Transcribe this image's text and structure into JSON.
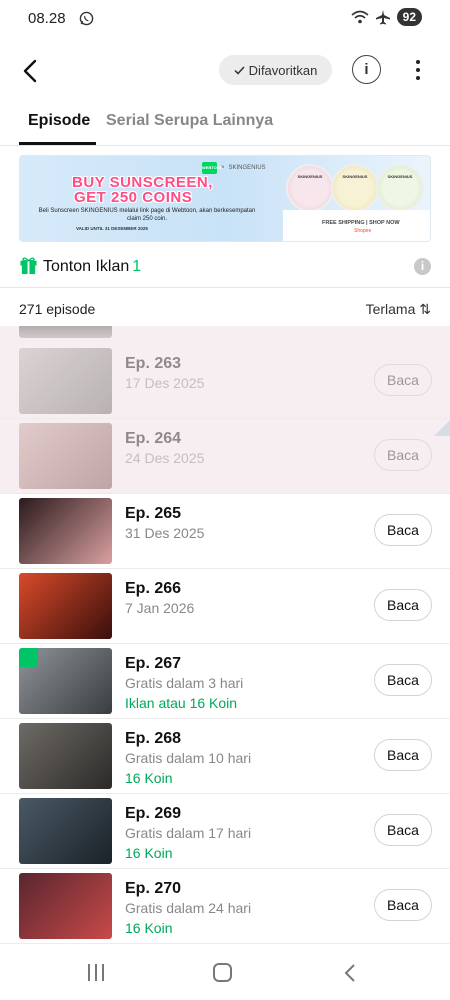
{
  "status_bar": {
    "time": "08.28",
    "battery": "92"
  },
  "header": {
    "favorite_label": "Difavoritkan",
    "info_label": "i"
  },
  "tabs": [
    {
      "label": "Episode"
    },
    {
      "label": "Serial Serupa Lainnya"
    }
  ],
  "banner": {
    "partner": "SKINGENIUS",
    "headline1": "BUY SUNSCREEN,",
    "headline2": "GET 250 COINS",
    "body": "Beli Sunscreen SKINGENIUS melalui link page di Webtoon, akan berkesempatan claim 250 coin.",
    "valid": "VALID UNTIL 31 DESEMBER 2025",
    "shipping": "FREE SHIPPING | SHOP NOW",
    "shop": "Shopee",
    "webtoon_logo": "WEBTOON",
    "cross": "×"
  },
  "ad_row": {
    "label": "Tonton Iklan",
    "count": "1"
  },
  "list_header": {
    "episode_count": "271 episode",
    "sort_label": "Terlama ⇅"
  },
  "episodes": [
    {
      "title": "Ep. 263",
      "line1": "17 Des 2025",
      "price": "",
      "button": "Baca",
      "faded": true,
      "thumb_colors": [
        "#b9b3b0",
        "#6d6866"
      ]
    },
    {
      "title": "Ep. 264",
      "line1": "24 Des 2025",
      "price": "",
      "button": "Baca",
      "faded": true,
      "thumb_colors": [
        "#c9a19c",
        "#7a4c4a"
      ]
    },
    {
      "title": "Ep. 265",
      "line1": "31 Des 2025",
      "price": "",
      "button": "Baca",
      "faded": false,
      "thumb_colors": [
        "#2b1a1c",
        "#d9a0a0"
      ]
    },
    {
      "title": "Ep. 266",
      "line1": "7 Jan 2026",
      "price": "",
      "button": "Baca",
      "faded": false,
      "thumb_colors": [
        "#d94a2a",
        "#3a0f0c"
      ]
    },
    {
      "title": "Ep. 267",
      "line1": "Gratis dalam 3 hari",
      "price": "Iklan atau 16 Koin",
      "button": "Baca",
      "faded": false,
      "thumb_colors": [
        "#8f9498",
        "#3a3d40"
      ]
    },
    {
      "title": "Ep. 268",
      "line1": "Gratis dalam 10 hari",
      "price": "16 Koin",
      "button": "Baca",
      "faded": false,
      "thumb_colors": [
        "#6e6a66",
        "#2c2a28"
      ]
    },
    {
      "title": "Ep. 269",
      "line1": "Gratis dalam 17 hari",
      "price": "16 Koin",
      "button": "Baca",
      "faded": false,
      "thumb_colors": [
        "#4a5966",
        "#1b2228"
      ]
    },
    {
      "title": "Ep. 270",
      "line1": "Gratis dalam 24 hari",
      "price": "16 Koin",
      "button": "Baca",
      "faded": false,
      "thumb_colors": [
        "#5a2530",
        "#c84a48"
      ]
    }
  ],
  "colors": {
    "accent_green": "#00c567",
    "price_green": "#00a85a",
    "banner_pink": "#ff4d86"
  },
  "icons": [
    "back-arrow-icon",
    "check-icon",
    "info-icon",
    "more-vertical-icon",
    "gift-icon",
    "sort-icon",
    "whatsapp-icon",
    "wifi-icon",
    "airplane-icon"
  ]
}
